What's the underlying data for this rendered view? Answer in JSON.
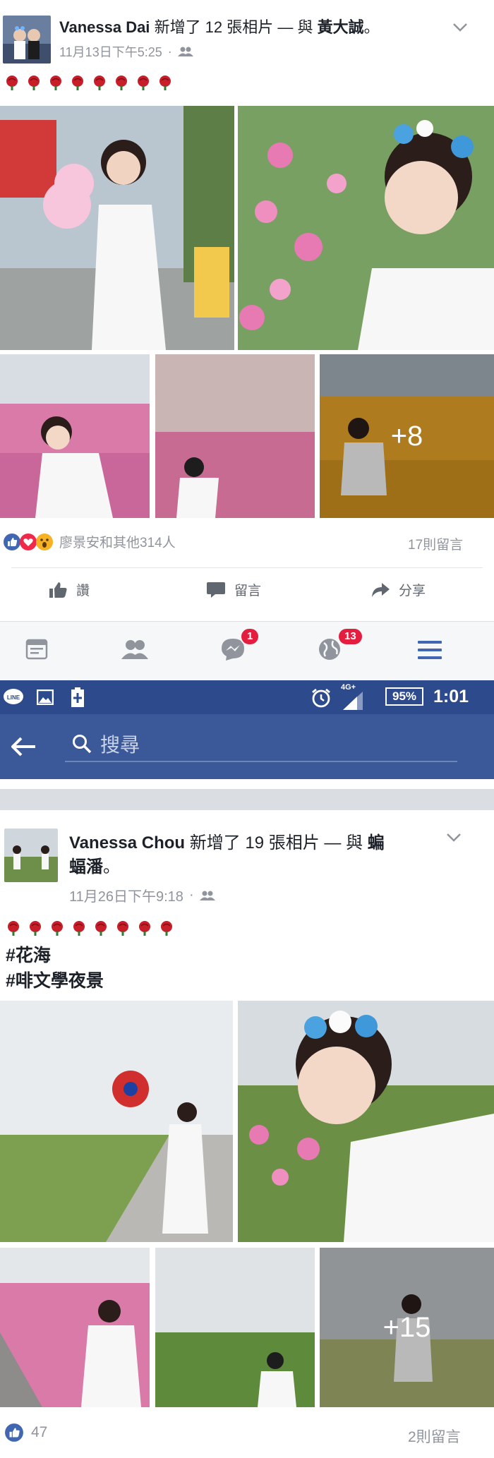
{
  "post1": {
    "author": "Vanessa Dai",
    "action_text": "新增了 12 張相片 — 與",
    "tagged": "黃大誠",
    "end_punct": "。",
    "time": "11月13日下午5:25",
    "dot": "·",
    "roses_count": 8,
    "more_photos": "+8",
    "reactions_text": "廖景安和其他314人",
    "comments": "17則留言",
    "like_label": "讚",
    "comment_label": "留言",
    "share_label": "分享"
  },
  "navbar": {
    "messages_badge": "1",
    "notifications_badge": "13"
  },
  "statusbar": {
    "network": "4G+",
    "battery": "95%",
    "time": "1:01"
  },
  "search": {
    "placeholder": "搜尋"
  },
  "post2": {
    "author": "Vanessa Chou",
    "action_text": "新增了 19 張相片 — 與",
    "tagged_line1": "蝙",
    "tagged_line2": "蝠潘",
    "end_punct": "。",
    "time": "11月26日下午9:18",
    "dot": "·",
    "roses_count": 8,
    "hashtag1": "#花海",
    "hashtag2": "#啡文學夜景",
    "more_photos": "+15",
    "likes": "47",
    "comments": "2則留言"
  },
  "colors": {
    "fb_blue": "#3b5998",
    "status_blue": "#2d4a8c",
    "badge_red": "#e41e3f",
    "meta_gray": "#90949c"
  }
}
